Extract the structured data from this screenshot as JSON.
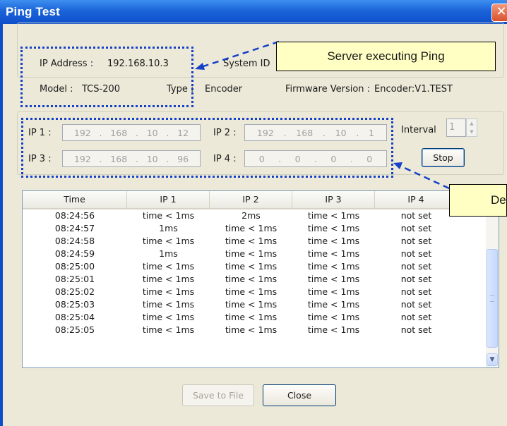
{
  "window": {
    "title": "Ping Test",
    "close_glyph": "✕"
  },
  "server_info": {
    "ip_address_label": "IP Address :",
    "ip_address": "192.168.10.3",
    "system_id_label": "System ID",
    "model_label": "Model :",
    "model": "TCS-200",
    "type_label": "Type :",
    "type": "Encoder",
    "firmware_label": "Firmware Version :",
    "firmware": "Encoder:V1.TEST"
  },
  "targets": [
    {
      "label": "IP 1 :",
      "octets": [
        "192",
        "168",
        "10",
        "12"
      ]
    },
    {
      "label": "IP 2 :",
      "octets": [
        "192",
        "168",
        "10",
        "1"
      ]
    },
    {
      "label": "IP 3 :",
      "octets": [
        "192",
        "168",
        "10",
        "96"
      ]
    },
    {
      "label": "IP 4 :",
      "octets": [
        "0",
        "0",
        "0",
        "0"
      ]
    }
  ],
  "interval": {
    "label": "Interval",
    "value": "1"
  },
  "stop_button": "Stop",
  "table": {
    "columns": [
      "Time",
      "IP 1",
      "IP 2",
      "IP 3",
      "IP 4"
    ],
    "rows": [
      [
        "08:24:56",
        "time < 1ms",
        "2ms",
        "time < 1ms",
        "not set"
      ],
      [
        "08:24:57",
        "1ms",
        "time < 1ms",
        "time < 1ms",
        "not set"
      ],
      [
        "08:24:58",
        "time < 1ms",
        "time < 1ms",
        "time < 1ms",
        "not set"
      ],
      [
        "08:24:59",
        "1ms",
        "time < 1ms",
        "time < 1ms",
        "not set"
      ],
      [
        "08:25:00",
        "time < 1ms",
        "time < 1ms",
        "time < 1ms",
        "not set"
      ],
      [
        "08:25:01",
        "time < 1ms",
        "time < 1ms",
        "time < 1ms",
        "not set"
      ],
      [
        "08:25:02",
        "time < 1ms",
        "time < 1ms",
        "time < 1ms",
        "not set"
      ],
      [
        "08:25:03",
        "time < 1ms",
        "time < 1ms",
        "time < 1ms",
        "not set"
      ],
      [
        "08:25:04",
        "time < 1ms",
        "time < 1ms",
        "time < 1ms",
        "not set"
      ],
      [
        "08:25:05",
        "time < 1ms",
        "time < 1ms",
        "time < 1ms",
        "not set"
      ]
    ]
  },
  "buttons": {
    "save": "Save to File",
    "close": "Close"
  },
  "annotations": {
    "server": "Server executing Ping",
    "destinations": "Des"
  },
  "colors": {
    "annotation_blue": "#1540c8",
    "titlebar": "#1b63d8",
    "callout_fill": "#ffffc4"
  }
}
